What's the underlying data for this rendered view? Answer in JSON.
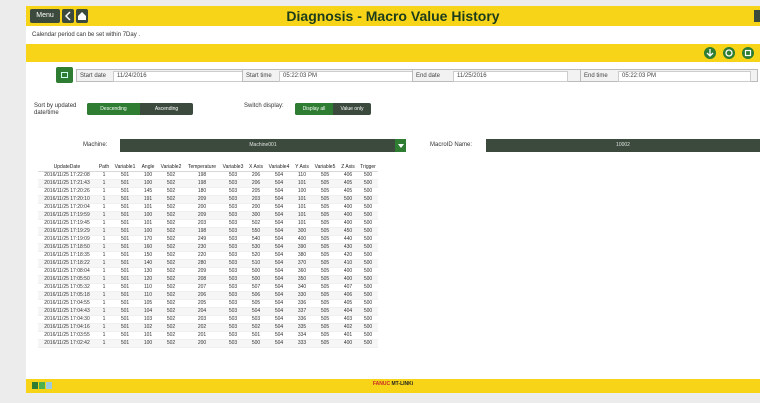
{
  "header": {
    "menu_label": "Menu",
    "title": "Diagnosis - Macro Value History"
  },
  "info_text": "Calendar period can be set within 7Day .",
  "toolbar_icons": [
    "download-icon",
    "refresh-icon",
    "settings-icon"
  ],
  "filters": {
    "start_date": {
      "label": "Start date",
      "value": "11/24/2016"
    },
    "start_time": {
      "label": "Start time",
      "value": "05:22:03 PM"
    },
    "end_date": {
      "label": "End date",
      "value": "11/25/2016"
    },
    "end_time": {
      "label": "End time",
      "value": "05:22:03 PM"
    }
  },
  "sort": {
    "label": "Sort by updated date/time",
    "options": [
      "Descending",
      "Ascending"
    ],
    "selected": "Descending"
  },
  "switch_display": {
    "label": "Switch display:",
    "options": [
      "Display all",
      "Value only"
    ],
    "selected": "Display all"
  },
  "machine": {
    "label": "Machine:",
    "value": "Machine001"
  },
  "macro_name": {
    "label": "MacroID Name:",
    "value": "10002"
  },
  "table": {
    "headers": [
      "UpdateDate",
      "Path",
      "Variable1",
      "Angle",
      "Variable2",
      "Temperature",
      "Variable3",
      "X Axis",
      "Variable4",
      "Y Axis",
      "Variable5",
      "Z Axis",
      "Trigger"
    ],
    "rows": [
      [
        "2016/11/25 17:22:08",
        "1",
        "501",
        "100",
        "502",
        "198",
        "503",
        "206",
        "504",
        "110",
        "505",
        "406",
        "500"
      ],
      [
        "2016/11/25 17:21:43",
        "1",
        "501",
        "100",
        "502",
        "198",
        "503",
        "206",
        "504",
        "101",
        "505",
        "405",
        "500"
      ],
      [
        "2016/11/25 17:20:26",
        "1",
        "501",
        "145",
        "502",
        "180",
        "503",
        "205",
        "504",
        "100",
        "505",
        "405",
        "500"
      ],
      [
        "2016/11/25 17:20:10",
        "1",
        "501",
        "191",
        "502",
        "209",
        "503",
        "203",
        "504",
        "101",
        "505",
        "500",
        "500"
      ],
      [
        "2016/11/25 17:20:04",
        "1",
        "501",
        "101",
        "502",
        "200",
        "503",
        "200",
        "504",
        "101",
        "505",
        "400",
        "500"
      ],
      [
        "2016/11/25 17:19:59",
        "1",
        "501",
        "100",
        "502",
        "209",
        "503",
        "300",
        "504",
        "101",
        "505",
        "400",
        "500"
      ],
      [
        "2016/11/25 17:19:45",
        "1",
        "501",
        "101",
        "502",
        "203",
        "503",
        "502",
        "504",
        "101",
        "505",
        "400",
        "500"
      ],
      [
        "2016/11/25 17:19:29",
        "1",
        "501",
        "100",
        "502",
        "198",
        "503",
        "550",
        "504",
        "300",
        "505",
        "450",
        "500"
      ],
      [
        "2016/11/25 17:19:09",
        "1",
        "501",
        "170",
        "502",
        "249",
        "503",
        "540",
        "504",
        "400",
        "505",
        "440",
        "500"
      ],
      [
        "2016/11/25 17:18:50",
        "1",
        "501",
        "160",
        "502",
        "230",
        "503",
        "530",
        "504",
        "390",
        "505",
        "430",
        "500"
      ],
      [
        "2016/11/25 17:18:35",
        "1",
        "501",
        "150",
        "502",
        "220",
        "503",
        "520",
        "504",
        "380",
        "505",
        "420",
        "500"
      ],
      [
        "2016/11/25 17:18:22",
        "1",
        "501",
        "140",
        "502",
        "280",
        "503",
        "510",
        "504",
        "370",
        "505",
        "410",
        "500"
      ],
      [
        "2016/11/25 17:08:04",
        "1",
        "501",
        "130",
        "502",
        "209",
        "503",
        "500",
        "504",
        "360",
        "505",
        "400",
        "500"
      ],
      [
        "2016/11/25 17:05:50",
        "1",
        "501",
        "120",
        "502",
        "208",
        "503",
        "500",
        "504",
        "350",
        "505",
        "400",
        "500"
      ],
      [
        "2016/11/25 17:05:32",
        "1",
        "501",
        "110",
        "502",
        "207",
        "503",
        "507",
        "504",
        "340",
        "505",
        "407",
        "500"
      ],
      [
        "2016/11/25 17:05:18",
        "1",
        "501",
        "110",
        "502",
        "206",
        "503",
        "506",
        "504",
        "330",
        "505",
        "406",
        "500"
      ],
      [
        "2016/11/25 17:04:55",
        "1",
        "501",
        "105",
        "502",
        "205",
        "503",
        "505",
        "504",
        "336",
        "505",
        "405",
        "500"
      ],
      [
        "2016/11/25 17:04:43",
        "1",
        "501",
        "104",
        "502",
        "204",
        "503",
        "504",
        "504",
        "337",
        "505",
        "404",
        "500"
      ],
      [
        "2016/11/25 17:04:30",
        "1",
        "501",
        "103",
        "502",
        "203",
        "503",
        "503",
        "504",
        "336",
        "505",
        "403",
        "500"
      ],
      [
        "2016/11/25 17:04:16",
        "1",
        "501",
        "102",
        "502",
        "202",
        "503",
        "502",
        "504",
        "335",
        "505",
        "402",
        "500"
      ],
      [
        "2016/11/25 17:03:55",
        "1",
        "501",
        "101",
        "502",
        "201",
        "503",
        "501",
        "504",
        "334",
        "505",
        "401",
        "500"
      ],
      [
        "2016/11/25 17:02:42",
        "1",
        "501",
        "100",
        "502",
        "200",
        "503",
        "500",
        "504",
        "333",
        "505",
        "400",
        "500"
      ]
    ]
  },
  "footer": {
    "brand_prefix": "FANUC",
    "brand_suffix": "MT-LINKi"
  },
  "colors": {
    "accent_yellow": "#f7d417",
    "dark_green": "#3b4a3c",
    "green": "#2e7d32"
  }
}
